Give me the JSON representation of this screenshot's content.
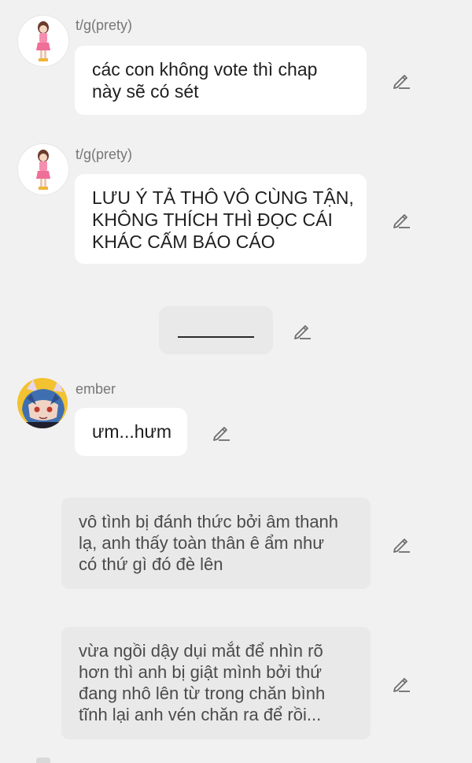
{
  "messages": [
    {
      "sender": "t/g(prety)",
      "lines": [
        "các con không vote thì chap",
        "này sẽ có sét"
      ],
      "avatar": "girl-avatar"
    },
    {
      "sender": "t/g(prety)",
      "lines": [
        "LƯU Ý TẢ THÔ VÔ CÙNG TẬN,",
        "KHÔNG THÍCH THÌ ĐỌC CÁI",
        "KHÁC CẤM BÁO CÁO"
      ],
      "avatar": "girl-avatar"
    },
    {
      "sender": "ember",
      "lines": [
        "ưm...hưm"
      ],
      "avatar": "ember-avatar"
    }
  ],
  "narrations": [
    {
      "lines": [
        "vô tình bị đánh thức bởi âm thanh",
        "lạ, anh thấy toàn thân ê ẩm như",
        "có thứ gì đó đè lên"
      ]
    },
    {
      "lines": [
        "vừa ngồi dậy dụi mắt để nhìn rõ",
        "hơn thì anh bị giật mình bởi thứ",
        "đang nhô lên từ trong chăn bình",
        "tĩnh lại anh vén chăn ra để rồi..."
      ]
    }
  ],
  "colors": {
    "background": "#f1f1f1",
    "bubble": "#ffffff",
    "narration": "#e9e9e9",
    "name": "#777777",
    "text": "#1e1e1e",
    "icon": "#6e6e6e"
  },
  "icons": {
    "edit": "pencil-icon"
  }
}
